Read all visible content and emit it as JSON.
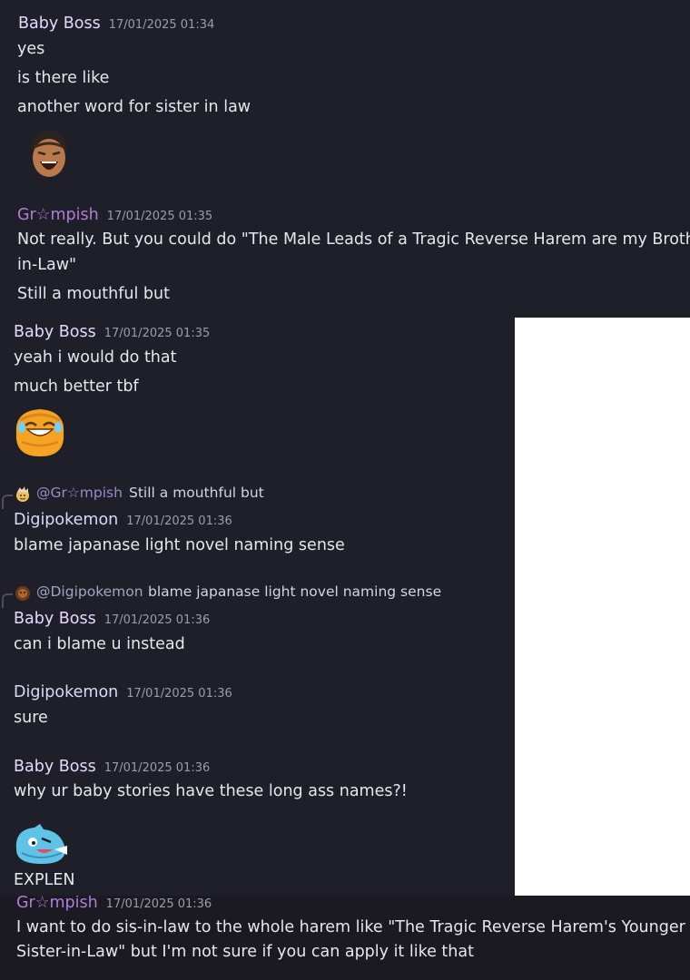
{
  "messages": {
    "m1": {
      "author": "Baby Boss",
      "timestamp": "17/01/2025 01:34",
      "lines": [
        "yes",
        "is there like",
        "another word for sister in law"
      ],
      "emoji": "laughing-man-emoji"
    },
    "m2": {
      "author": "Gr☆mpish",
      "timestamp": "17/01/2025 01:35",
      "lines": [
        "Not really. But you could do \"The Male Leads of a Tragic Reverse Harem are my Brothers-",
        "in-Law\"",
        "Still a mouthful but"
      ]
    },
    "m3": {
      "author": "Baby Boss",
      "timestamp": "17/01/2025 01:35",
      "lines": [
        "yeah i would do that",
        "much better tbf"
      ],
      "emoji": "crying-laughing-blob-emoji"
    },
    "m4": {
      "reply_to": {
        "mention": "@Gr☆mpish",
        "text": "Still a mouthful but"
      },
      "author": "Digipokemon",
      "timestamp": "17/01/2025 01:36",
      "lines": [
        "blame japanase light novel naming sense"
      ]
    },
    "m5": {
      "reply_to": {
        "mention": "@Digipokemon",
        "text": "blame japanase light novel naming sense"
      },
      "author": "Baby Boss",
      "timestamp": "17/01/2025 01:36",
      "lines": [
        "can i blame u instead"
      ]
    },
    "m6": {
      "author": "Digipokemon",
      "timestamp": "17/01/2025 01:36",
      "lines": [
        "sure"
      ]
    },
    "m7": {
      "author": "Baby Boss",
      "timestamp": "17/01/2025 01:36",
      "lines": [
        "why ur baby stories have these long ass names?!",
        "EXPLEN"
      ],
      "emoji": "blue-creature-emoji"
    },
    "m8": {
      "author": "Gr☆mpish",
      "timestamp": "17/01/2025 01:36",
      "lines": [
        "I want to do sis-in-law to the whole harem like \"The Tragic Reverse Harem's Younger",
        "Sister-in-Law\" but I'm not sure if you can apply it like that"
      ]
    }
  },
  "colors": {
    "baby_boss": "#e6d7ff",
    "grumpish": "#b27cd8",
    "digipokemon": "#d6dcf8",
    "background": "#1e1f29"
  }
}
